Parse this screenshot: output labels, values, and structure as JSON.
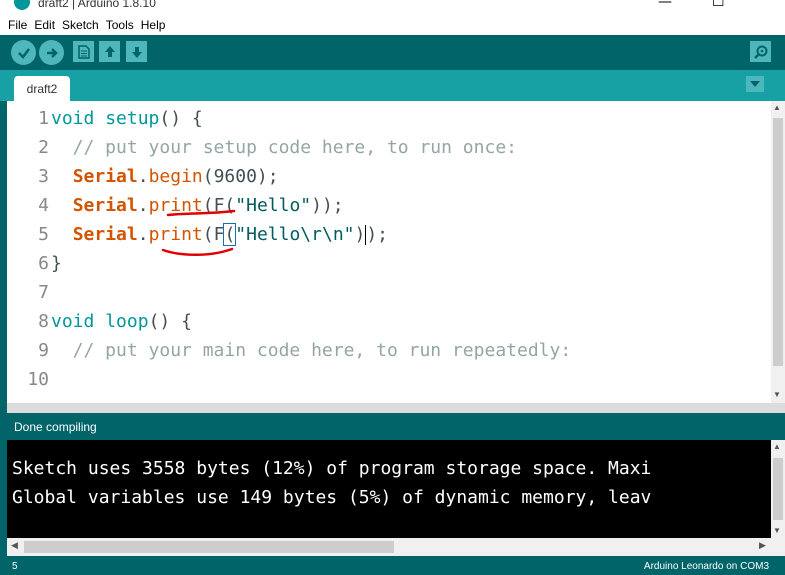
{
  "window": {
    "title": "draft2 | Arduino 1.8.10",
    "minimize": "—",
    "maximize": "☐"
  },
  "menu": {
    "items": [
      "File",
      "Edit",
      "Sketch",
      "Tools",
      "Help"
    ]
  },
  "tabs": [
    {
      "label": "draft2"
    }
  ],
  "editor": {
    "line_numbers": [
      "1",
      "2",
      "3",
      "4",
      "5",
      "6",
      "7",
      "8",
      "9",
      "10"
    ],
    "lines": {
      "l1": {
        "kw": "void",
        "fn": "setup",
        "rest": "() {"
      },
      "l2": {
        "comment": "  // put your setup code here, to run once:"
      },
      "l3": {
        "obj": "Serial",
        "dot": ".",
        "fn": "begin",
        "rest": "(9600);"
      },
      "l4": {
        "obj": "Serial",
        "dot": ".",
        "fn": "print",
        "open": "(F(",
        "str": "\"Hello\"",
        "rest": "));"
      },
      "l5": {
        "obj": "Serial",
        "dot": ".",
        "fn": "print",
        "open": "(F",
        "bracket": "(",
        "str": "\"Hello\\r\\n\"",
        "close": ")",
        "rest": ");"
      },
      "l6": {
        "rest": "}"
      },
      "l8": {
        "kw": "void",
        "fn": "loop",
        "rest": "() {"
      },
      "l9": {
        "comment": "  // put your main code here, to run repeatedly:"
      }
    }
  },
  "status": {
    "text": "Done compiling"
  },
  "console": {
    "line1": "Sketch uses 3558 bytes (12%) of program storage space. Maxi",
    "line2_pre": "Global variables use ",
    "line2_num": "149",
    "line2_post": " bytes (5%) of dynamic memory, leav"
  },
  "bottom": {
    "line": "5",
    "board": "Arduino Leonardo on COM3"
  },
  "colors": {
    "teal_dark": "#006468",
    "teal_mid": "#17a1a5",
    "button": "#4db7bb",
    "annotation": "#e00000"
  }
}
